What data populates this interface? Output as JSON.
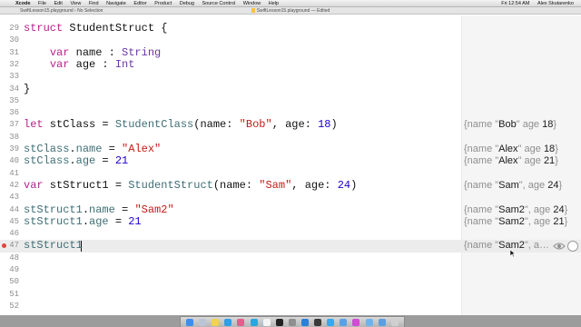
{
  "menubar": {
    "apple_glyph": "",
    "app_name": "Xcode",
    "menus": [
      "File",
      "Edit",
      "View",
      "Find",
      "Navigate",
      "Editor",
      "Product",
      "Debug",
      "Source Control",
      "Window",
      "Help"
    ],
    "clock": "Fri 12:54 AM",
    "user": "Alex Skutarenko"
  },
  "titlebar": {
    "breadcrumb": "SwiftLesson15.playground › No Selection",
    "document_title": "SwiftLesson15.playground — Edited"
  },
  "lines": [
    {
      "num": "29",
      "tokens": [
        {
          "t": "struct",
          "c": "kw"
        },
        {
          "t": " StudentStruct {",
          "c": ""
        }
      ]
    },
    {
      "num": "30",
      "tokens": []
    },
    {
      "num": "31",
      "tokens": [
        {
          "t": "    ",
          "c": ""
        },
        {
          "t": "var",
          "c": "kw"
        },
        {
          "t": " name : ",
          "c": ""
        },
        {
          "t": "String",
          "c": "type"
        }
      ]
    },
    {
      "num": "32",
      "tokens": [
        {
          "t": "    ",
          "c": ""
        },
        {
          "t": "var",
          "c": "kw"
        },
        {
          "t": " age : ",
          "c": ""
        },
        {
          "t": "Int",
          "c": "type"
        }
      ]
    },
    {
      "num": "33",
      "tokens": []
    },
    {
      "num": "34",
      "tokens": [
        {
          "t": "}",
          "c": ""
        }
      ]
    },
    {
      "num": "35",
      "tokens": []
    },
    {
      "num": "36",
      "tokens": []
    },
    {
      "num": "37",
      "tokens": [
        {
          "t": "let",
          "c": "kw"
        },
        {
          "t": " stClass = ",
          "c": ""
        },
        {
          "t": "StudentClass",
          "c": "ident"
        },
        {
          "t": "(name: ",
          "c": ""
        },
        {
          "t": "\"Bob\"",
          "c": "str"
        },
        {
          "t": ", age: ",
          "c": ""
        },
        {
          "t": "18",
          "c": "num"
        },
        {
          "t": ")",
          "c": ""
        }
      ]
    },
    {
      "num": "38",
      "tokens": []
    },
    {
      "num": "39",
      "tokens": [
        {
          "t": "stClass",
          "c": "ident"
        },
        {
          "t": ".",
          "c": ""
        },
        {
          "t": "name",
          "c": "ident"
        },
        {
          "t": " = ",
          "c": ""
        },
        {
          "t": "\"Alex\"",
          "c": "str"
        }
      ]
    },
    {
      "num": "40",
      "tokens": [
        {
          "t": "stClass",
          "c": "ident"
        },
        {
          "t": ".",
          "c": ""
        },
        {
          "t": "age",
          "c": "ident"
        },
        {
          "t": " = ",
          "c": ""
        },
        {
          "t": "21",
          "c": "num"
        }
      ]
    },
    {
      "num": "41",
      "tokens": []
    },
    {
      "num": "42",
      "tokens": [
        {
          "t": "var",
          "c": "kw"
        },
        {
          "t": " stStruct1 = ",
          "c": ""
        },
        {
          "t": "StudentStruct",
          "c": "ident"
        },
        {
          "t": "(name: ",
          "c": ""
        },
        {
          "t": "\"Sam\"",
          "c": "str"
        },
        {
          "t": ", age: ",
          "c": ""
        },
        {
          "t": "24",
          "c": "num"
        },
        {
          "t": ")",
          "c": ""
        }
      ]
    },
    {
      "num": "43",
      "tokens": []
    },
    {
      "num": "44",
      "tokens": [
        {
          "t": "stStruct1",
          "c": "ident"
        },
        {
          "t": ".",
          "c": ""
        },
        {
          "t": "name",
          "c": "ident"
        },
        {
          "t": " = ",
          "c": ""
        },
        {
          "t": "\"Sam2\"",
          "c": "str"
        }
      ]
    },
    {
      "num": "45",
      "tokens": [
        {
          "t": "stStruct1",
          "c": "ident"
        },
        {
          "t": ".",
          "c": ""
        },
        {
          "t": "age",
          "c": "ident"
        },
        {
          "t": " = ",
          "c": ""
        },
        {
          "t": "21",
          "c": "num"
        }
      ]
    },
    {
      "num": "46",
      "tokens": []
    },
    {
      "num": "47",
      "tokens": [
        {
          "t": "stStruct1",
          "c": "ident"
        }
      ]
    },
    {
      "num": "48",
      "tokens": []
    },
    {
      "num": "49",
      "tokens": []
    },
    {
      "num": "50",
      "tokens": []
    },
    {
      "num": "51",
      "tokens": []
    },
    {
      "num": "52",
      "tokens": []
    }
  ],
  "results": [
    {
      "line": "37",
      "parts": [
        {
          "t": "{name \"",
          "c": ""
        },
        {
          "t": "Bob",
          "c": "dark"
        },
        {
          "t": "\" age ",
          "c": ""
        },
        {
          "t": "18",
          "c": "dark"
        },
        {
          "t": "}",
          "c": ""
        }
      ]
    },
    {
      "line": "39",
      "parts": [
        {
          "t": "{name \"",
          "c": ""
        },
        {
          "t": "Alex",
          "c": "dark"
        },
        {
          "t": "\" age ",
          "c": ""
        },
        {
          "t": "18",
          "c": "dark"
        },
        {
          "t": "}",
          "c": ""
        }
      ]
    },
    {
      "line": "40",
      "parts": [
        {
          "t": "{name \"",
          "c": ""
        },
        {
          "t": "Alex",
          "c": "dark"
        },
        {
          "t": "\" age ",
          "c": ""
        },
        {
          "t": "21",
          "c": "dark"
        },
        {
          "t": "}",
          "c": ""
        }
      ]
    },
    {
      "line": "42",
      "parts": [
        {
          "t": "{name \"",
          "c": ""
        },
        {
          "t": "Sam",
          "c": "dark"
        },
        {
          "t": "\", age ",
          "c": ""
        },
        {
          "t": "24",
          "c": "dark"
        },
        {
          "t": "}",
          "c": ""
        }
      ]
    },
    {
      "line": "44",
      "parts": [
        {
          "t": "{name \"",
          "c": ""
        },
        {
          "t": "Sam2",
          "c": "dark"
        },
        {
          "t": "\", age ",
          "c": ""
        },
        {
          "t": "24",
          "c": "dark"
        },
        {
          "t": "}",
          "c": ""
        }
      ]
    },
    {
      "line": "45",
      "parts": [
        {
          "t": "{name \"",
          "c": ""
        },
        {
          "t": "Sam2",
          "c": "dark"
        },
        {
          "t": "\", age ",
          "c": ""
        },
        {
          "t": "21",
          "c": "dark"
        },
        {
          "t": "}",
          "c": ""
        }
      ]
    },
    {
      "line": "47",
      "parts": [
        {
          "t": "{name \"",
          "c": ""
        },
        {
          "t": "Sam2",
          "c": "dark"
        },
        {
          "t": "\", a…",
          "c": ""
        }
      ]
    }
  ],
  "current_line": "47",
  "error_line": "47",
  "icons": {
    "error": "error-dot-icon",
    "quick_look": "eye-icon",
    "result_toggle": "circle-icon",
    "pointer": "mouse-pointer-icon"
  },
  "dock_icons": [
    {
      "name": "finder-icon",
      "color": "#3b8df0"
    },
    {
      "name": "launchpad-icon",
      "color": "#b9c4d6"
    },
    {
      "name": "notes-icon",
      "color": "#f1d34c"
    },
    {
      "name": "safari-icon",
      "color": "#2f9fe8"
    },
    {
      "name": "photos-icon",
      "color": "#e55c8d"
    },
    {
      "name": "skype-icon",
      "color": "#2aa6e0"
    },
    {
      "name": "calendar-icon",
      "color": "#f4f4f4"
    },
    {
      "name": "terminal-icon",
      "color": "#222222"
    },
    {
      "name": "preferences-icon",
      "color": "#8f8f8f"
    },
    {
      "name": "xcode-icon",
      "color": "#2c7fd6"
    },
    {
      "name": "simulator-icon",
      "color": "#3a3a3a"
    },
    {
      "name": "app-store-icon",
      "color": "#39a7ec"
    },
    {
      "name": "mail-icon",
      "color": "#5aa0e6"
    },
    {
      "name": "itunes-icon",
      "color": "#d14bd4"
    },
    {
      "name": "folder-icon",
      "color": "#6fb3ee"
    },
    {
      "name": "downloads-icon",
      "color": "#5b9fe0"
    },
    {
      "name": "trash-icon",
      "color": "#cfcfcf"
    }
  ],
  "colors": {
    "keyword": "#b5238b",
    "type": "#6c36a9",
    "string": "#c41a16",
    "number": "#1c00cf",
    "identifier": "#3f6e74",
    "results_pane": "#f5f5f5",
    "current_line": "#ececec"
  }
}
